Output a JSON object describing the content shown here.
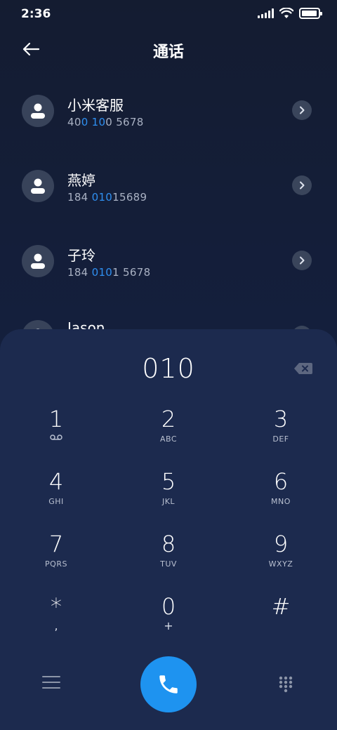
{
  "status_bar": {
    "time": "2:36",
    "battery_level": 0.95,
    "icons": [
      "signal-icon",
      "wifi-icon",
      "battery-icon"
    ]
  },
  "header": {
    "title": "通话",
    "back_icon": "arrow-left-icon"
  },
  "contacts": [
    {
      "name": "小米客服",
      "number_parts": [
        [
          "40",
          false
        ],
        [
          "0",
          true
        ],
        [
          " ",
          false
        ],
        [
          "10",
          true
        ],
        [
          "0 5678",
          false
        ]
      ]
    },
    {
      "name": "燕婷",
      "number_parts": [
        [
          "184 ",
          false
        ],
        [
          "010",
          true
        ],
        [
          "15689",
          false
        ]
      ]
    },
    {
      "name": "子玲",
      "number_parts": [
        [
          "184 ",
          false
        ],
        [
          "010",
          true
        ],
        [
          "1 5678",
          false
        ]
      ]
    },
    {
      "name": "Jason",
      "number_parts": []
    }
  ],
  "dialer": {
    "input_value": "010",
    "keys": [
      {
        "digit": "1",
        "letters": "",
        "extra": "voicemail-icon"
      },
      {
        "digit": "2",
        "letters": "ABC"
      },
      {
        "digit": "3",
        "letters": "DEF"
      },
      {
        "digit": "4",
        "letters": "GHI"
      },
      {
        "digit": "5",
        "letters": "JKL"
      },
      {
        "digit": "6",
        "letters": "MNO"
      },
      {
        "digit": "7",
        "letters": "PQRS"
      },
      {
        "digit": "8",
        "letters": "TUV"
      },
      {
        "digit": "9",
        "letters": "WXYZ"
      },
      {
        "digit": "*",
        "letters": ","
      },
      {
        "digit": "0",
        "letters": "+"
      },
      {
        "digit": "#",
        "letters": ""
      }
    ]
  },
  "colors": {
    "background": "#141c31",
    "dialer_panel": "#1c2a4e",
    "highlight": "#2f8ff0",
    "call_button": "#1e93f0",
    "secondary_text": "#a9b1c3"
  }
}
